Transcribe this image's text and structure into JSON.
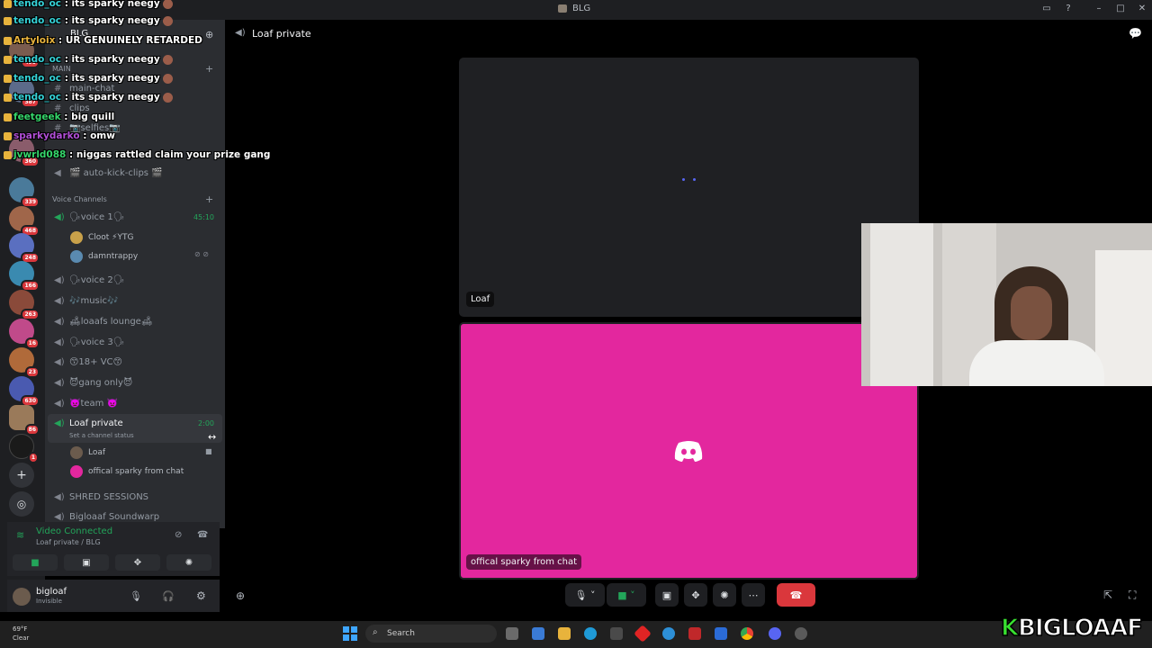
{
  "window": {
    "title": "BLG"
  },
  "server": {
    "name": "BLG",
    "category_main": "MAIN",
    "voice_category": "Voice Channels"
  },
  "rail_badges": [
    "499",
    "387",
    "360",
    "339",
    "468",
    "248",
    "166",
    "263",
    "16",
    "23",
    "630",
    "86",
    "1"
  ],
  "text_channels": [
    "main-chat",
    "clips",
    "📷selfies📷",
    "🎬 auto-kick-clips 🎬"
  ],
  "voice_channels": [
    {
      "name": "🗣voice 1🗣",
      "time": "45:10"
    },
    {
      "name": "🗣voice 2🗣",
      "time": ""
    },
    {
      "name": "🎶music🎶",
      "time": ""
    },
    {
      "name": "🛋loaafs lounge🛋",
      "time": ""
    },
    {
      "name": "🗣voice 3🗣",
      "time": ""
    },
    {
      "name": "😙18+ VC😙",
      "time": ""
    },
    {
      "name": "😈gang only😈",
      "time": ""
    },
    {
      "name": "👿team 👿",
      "time": ""
    },
    {
      "name": "Loaf private",
      "time": "2:00"
    },
    {
      "name": "SHRED SESSIONS",
      "time": ""
    },
    {
      "name": "Bigloaaf Soundwarp",
      "time": ""
    }
  ],
  "voice1_users": [
    "Cloot ⚡YTG",
    "damntrappy"
  ],
  "loaf_private": {
    "status": "Set a channel status",
    "users": [
      "Loaf",
      "offical sparky from chat"
    ]
  },
  "voice_connection": {
    "title": "Video Connected",
    "sub": "Loaf private / BLG"
  },
  "user": {
    "name": "bigloaf",
    "status": "Invisible"
  },
  "header": {
    "channel": "Loaf private"
  },
  "tiles": [
    {
      "label": "Loaf"
    },
    {
      "label": "offical sparky from chat"
    }
  ],
  "chat_overlay": [
    {
      "user": "tendo_oc",
      "msg": "its sparky neegy",
      "color": "#35d1d6"
    },
    {
      "user": "tendo_oc",
      "msg": "its sparky neegy",
      "color": "#35d1d6"
    },
    {
      "user": "Artyloix",
      "msg": "UR GENUINELY RETARDED",
      "color": "#e8b33c"
    },
    {
      "user": "tendo_oc",
      "msg": "its sparky neegy",
      "color": "#35d1d6"
    },
    {
      "user": "tendo_oc",
      "msg": "its sparky neegy",
      "color": "#35d1d6"
    },
    {
      "user": "tendo_oc",
      "msg": "its sparky neegy",
      "color": "#35d1d6"
    },
    {
      "user": "feetgeek",
      "msg": "big quill",
      "color": "#35d66b"
    },
    {
      "user": "sparkydarko",
      "msg": "omw",
      "color": "#b04fd6"
    },
    {
      "user": "jvwrld088",
      "msg": "niggas rattled claim your prize gang",
      "color": "#35d66b"
    }
  ],
  "taskbar": {
    "search_placeholder": "Search",
    "temp": "69°F",
    "condition": "Clear"
  },
  "brand": {
    "k": "K",
    "text": "BIGLOAAF"
  },
  "colors": {
    "accent": "#5865f2",
    "tile_pink": "#e3279e",
    "connected": "#23a55a",
    "end_call": "#da373c"
  }
}
